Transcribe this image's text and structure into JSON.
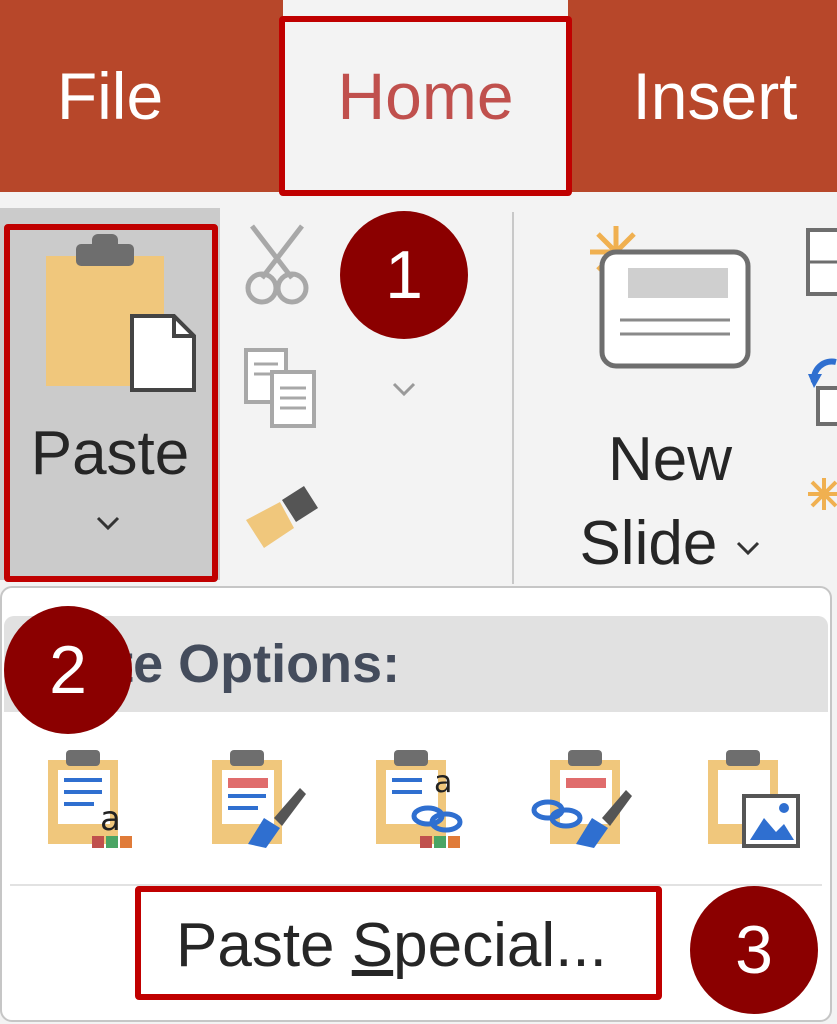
{
  "ribbon": {
    "tabs": [
      {
        "label": "File"
      },
      {
        "label": "Home",
        "active": true
      },
      {
        "label": "Insert"
      }
    ]
  },
  "clipboard": {
    "paste_label": "Paste",
    "icons": [
      "cut-icon",
      "copy-icon",
      "format-painter-icon",
      "copy-dropdown-icon"
    ]
  },
  "slides": {
    "new_slide_line1": "New",
    "new_slide_line2": "Slide"
  },
  "dropdown": {
    "header": "Paste Options:",
    "options": [
      "use-destination-theme-icon",
      "keep-source-formatting-icon",
      "embed-icon",
      "link-keep-formatting-icon",
      "picture-icon"
    ],
    "paste_special": {
      "before": "Paste ",
      "mnemonic": "S",
      "after": "pecial..."
    }
  },
  "steps": [
    "1",
    "2",
    "3"
  ],
  "colors": {
    "ribbon_bar": "#b7472a",
    "active_tab_text": "#c0504d",
    "highlight": "#c00000",
    "badge": "#8b0000"
  }
}
